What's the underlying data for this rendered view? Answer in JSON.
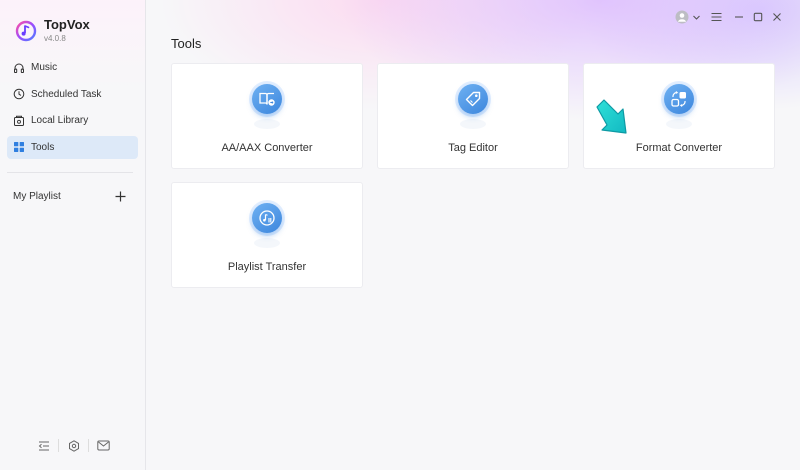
{
  "app": {
    "name": "TopVox",
    "version": "v4.0.8"
  },
  "sidebar": {
    "items": [
      {
        "label": "Music",
        "icon": "headphones-icon",
        "active": false
      },
      {
        "label": "Scheduled Task",
        "icon": "clock-icon",
        "active": false
      },
      {
        "label": "Local Library",
        "icon": "library-icon",
        "active": false
      },
      {
        "label": "Tools",
        "icon": "grid-icon",
        "active": true
      }
    ],
    "playlist_label": "My Playlist",
    "bottom_icons": [
      "collapse-sidebar-icon",
      "settings-icon",
      "mail-icon"
    ]
  },
  "window_controls": [
    "avatar-icon",
    "menu-icon",
    "minimize-icon",
    "maximize-icon",
    "close-icon"
  ],
  "main": {
    "title": "Tools",
    "tools": [
      {
        "label": "AA/AAX Converter",
        "icon": "book-convert-icon"
      },
      {
        "label": "Tag Editor",
        "icon": "tag-icon"
      },
      {
        "label": "Format Converter",
        "icon": "format-convert-icon"
      },
      {
        "label": "Playlist Transfer",
        "icon": "playlist-transfer-icon"
      }
    ]
  },
  "colors": {
    "accent": "#3c86dd",
    "active_nav_bg": "#dde9f8",
    "arrow": "#17c9c9"
  }
}
